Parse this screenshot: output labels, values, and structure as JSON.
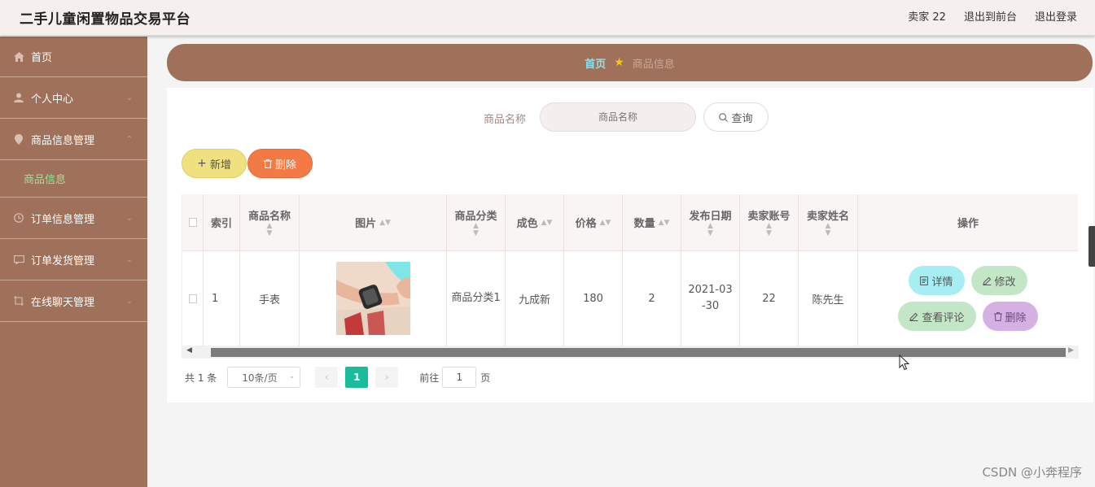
{
  "header": {
    "title": "二手儿童闲置物品交易平台",
    "user": "卖家 22",
    "back_front": "退出到前台",
    "logout": "退出登录"
  },
  "sidebar": {
    "items": [
      {
        "label": "首页",
        "icon": "home-icon"
      },
      {
        "label": "个人中心",
        "icon": "user-icon"
      },
      {
        "label": "商品信息管理",
        "icon": "location-icon"
      },
      {
        "label": "订单信息管理",
        "icon": "clock-icon"
      },
      {
        "label": "订单发货管理",
        "icon": "message-icon"
      },
      {
        "label": "在线聊天管理",
        "icon": "crop-icon"
      }
    ],
    "sub_item": "商品信息"
  },
  "breadcrumb": {
    "home": "首页",
    "current": "商品信息"
  },
  "search": {
    "label": "商品名称",
    "placeholder": "商品名称",
    "button": "查询"
  },
  "actions": {
    "add": "新增",
    "delete": "删除"
  },
  "table": {
    "headers": [
      "索引",
      "商品名称",
      "图片",
      "商品分类",
      "成色",
      "价格",
      "数量",
      "发布日期",
      "卖家账号",
      "卖家姓名",
      "操作"
    ],
    "row": {
      "index": "1",
      "name": "手表",
      "category": "商品分类1",
      "condition": "九成新",
      "price": "180",
      "quantity": "2",
      "date": "2021-03-30",
      "seller_account": "22",
      "seller_name": "陈先生"
    },
    "ops": {
      "detail": "详情",
      "edit": "修改",
      "comment": "查看评论",
      "delete": "删除"
    }
  },
  "pagination": {
    "total": "共 1 条",
    "page_size": "10条/页",
    "current_page": "1",
    "goto_label": "前往",
    "goto_value": "1",
    "page_suffix": "页"
  },
  "watermark": "CSDN @小奔程序",
  "colors": {
    "sidebar_bg": "#a0715a",
    "accent_green": "#1abc9c",
    "submenu_active": "#9be29b"
  }
}
